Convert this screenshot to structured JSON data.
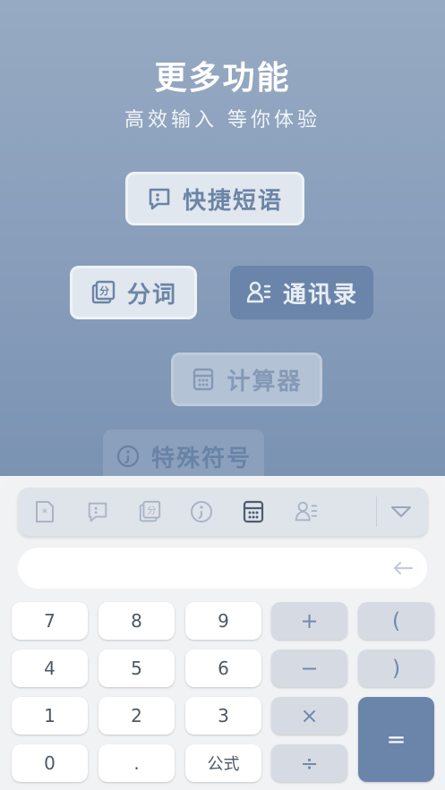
{
  "hero": {
    "title": "更多功能",
    "subtitle": "高效输入 等你体验",
    "features": {
      "quick_phrase": "快捷短语",
      "segmentation": "分词",
      "contacts": "通讯录",
      "calculator": "计算器",
      "special_symbols": "特殊符号"
    }
  },
  "toolbar": {
    "icons": [
      "special-symbol-doc-icon",
      "quick-phrase-icon",
      "segmentation-icon",
      "special-symbol-icon",
      "calculator-icon",
      "contacts-icon",
      "collapse-keyboard-icon"
    ],
    "active": "calculator-icon"
  },
  "display": {
    "value": "",
    "backspace_icon": "backspace-arrow-icon"
  },
  "keys": {
    "digits": [
      "7",
      "8",
      "9",
      "4",
      "5",
      "6",
      "1",
      "2",
      "3",
      "0",
      "."
    ],
    "formula": "公式",
    "plus": "+",
    "minus": "−",
    "multiply": "×",
    "divide": "÷",
    "lparen": "(",
    "rparen": ")",
    "equals": "="
  },
  "colors": {
    "accent": "#6a85a9",
    "hero_top": "#97aac3",
    "hero_bottom": "#7b93b3",
    "keyboard_bg": "#f1f2f4"
  }
}
